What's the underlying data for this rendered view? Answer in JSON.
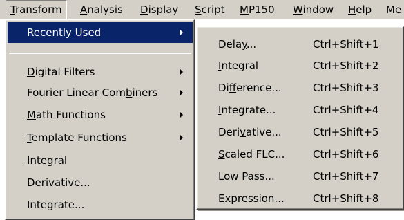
{
  "menubar": {
    "items": [
      {
        "pre": "",
        "u": "T",
        "post": "ransform"
      },
      {
        "pre": "",
        "u": "A",
        "post": "nalysis"
      },
      {
        "pre": "",
        "u": "D",
        "post": "isplay"
      },
      {
        "pre": "",
        "u": "S",
        "post": "cript"
      },
      {
        "pre": "",
        "u": "M",
        "post": "P150"
      },
      {
        "pre": "",
        "u": "W",
        "post": "indow"
      },
      {
        "pre": "",
        "u": "H",
        "post": "elp"
      },
      {
        "pre": "",
        "u": "",
        "post": "Me"
      }
    ]
  },
  "transform_menu": {
    "items": [
      {
        "pre": "Recently ",
        "u": "U",
        "post": "sed"
      },
      {
        "pre": "",
        "u": "D",
        "post": "igital Filters"
      },
      {
        "pre": "Fourier Linear Com",
        "u": "b",
        "post": "iners"
      },
      {
        "pre": "",
        "u": "M",
        "post": "ath Functions"
      },
      {
        "pre": "",
        "u": "T",
        "post": "emplate Functions"
      },
      {
        "pre": "",
        "u": "I",
        "post": "ntegral"
      },
      {
        "pre": "Deri",
        "u": "v",
        "post": "ative..."
      },
      {
        "pre": "Integrate...",
        "u": "",
        "post": ""
      }
    ]
  },
  "recently_used": {
    "items": [
      {
        "pre": "Dela",
        "u": "y",
        "post": "...",
        "shortcut": "Ctrl+Shift+1"
      },
      {
        "pre": "",
        "u": "I",
        "post": "ntegral",
        "shortcut": "Ctrl+Shift+2"
      },
      {
        "pre": "Di",
        "u": "f",
        "post": "ference...",
        "shortcut": "Ctrl+Shift+3"
      },
      {
        "pre": "",
        "u": "I",
        "post": "ntegrate...",
        "shortcut": "Ctrl+Shift+4"
      },
      {
        "pre": "Deri",
        "u": "v",
        "post": "ative...",
        "shortcut": "Ctrl+Shift+5"
      },
      {
        "pre": "",
        "u": "S",
        "post": "caled FLC...",
        "shortcut": "Ctrl+Shift+6"
      },
      {
        "pre": "",
        "u": "L",
        "post": "ow Pass...",
        "shortcut": "Ctrl+Shift+7"
      },
      {
        "pre": "",
        "u": "E",
        "post": "xpression...",
        "shortcut": "Ctrl+Shift+8"
      }
    ]
  }
}
